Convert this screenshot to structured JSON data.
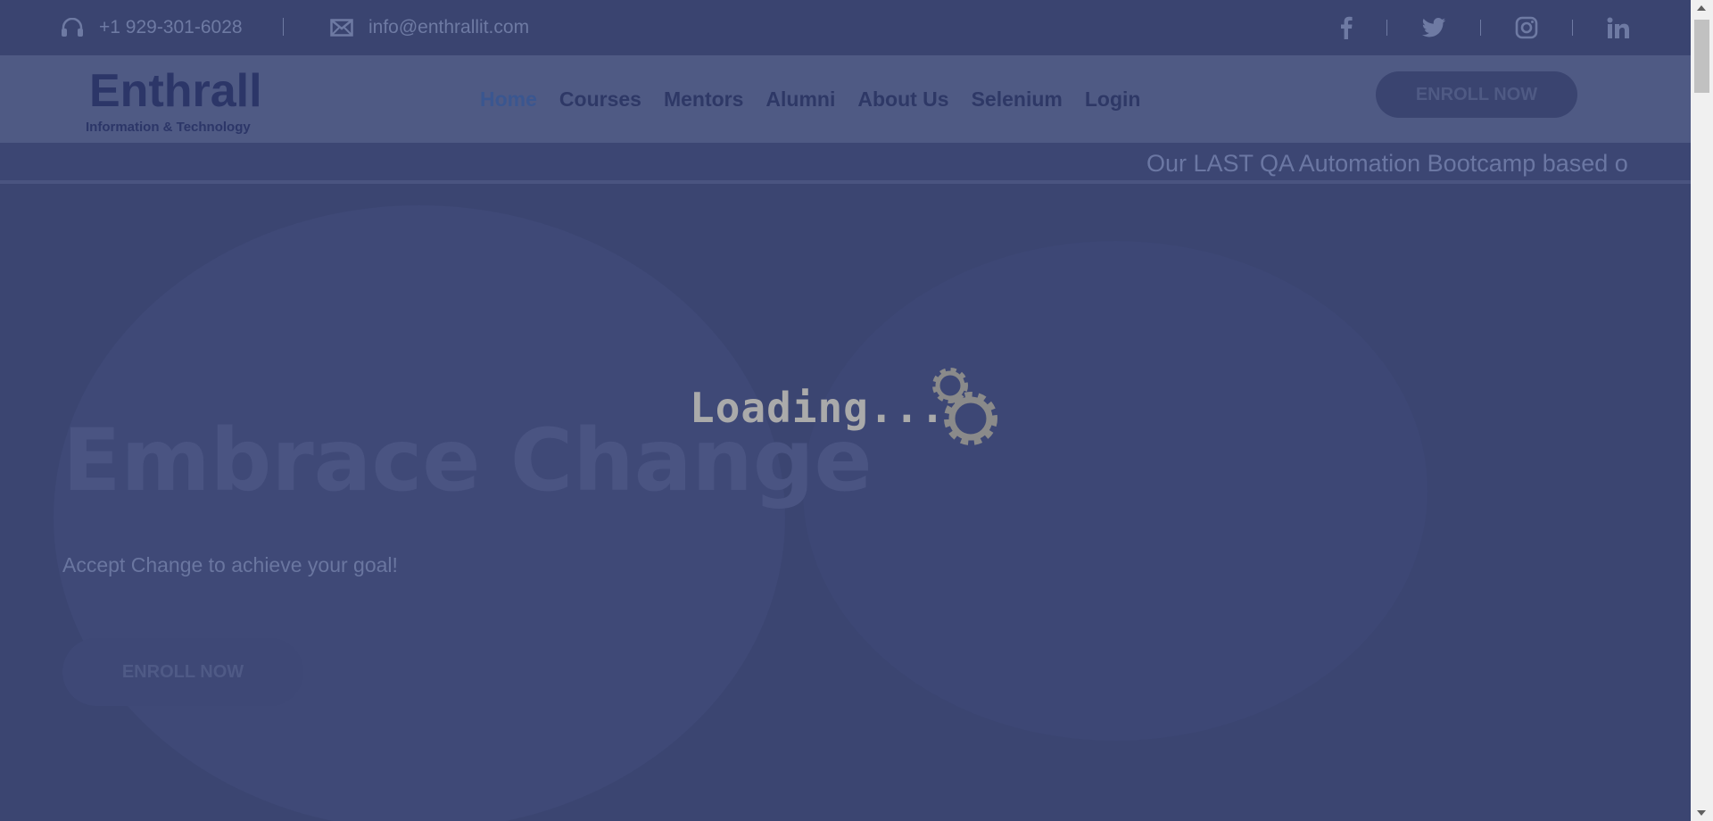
{
  "topbar": {
    "phone": "+1 929-301-6028",
    "email": "info@enthrallit.com",
    "social_icons": [
      "facebook-icon",
      "twitter-icon",
      "instagram-icon",
      "linkedin-icon"
    ]
  },
  "header": {
    "logo_word": "Enthrall",
    "logo_sub": "Information & Technology",
    "nav": [
      "Home",
      "Courses",
      "Mentors",
      "Alumni",
      "About Us",
      "Selenium",
      "Login"
    ],
    "active_nav": "Home",
    "enroll_label": "ENROLL NOW"
  },
  "ticker": {
    "text": "Our LAST QA Automation Bootcamp based o"
  },
  "hero": {
    "title": "Embrace Change",
    "subtitle": "Accept Change to achieve your goal!",
    "button_label": "ENROLL NOW"
  },
  "loader": {
    "text": "Loading..."
  },
  "colors": {
    "overlay": "#3b4571",
    "header": "#4f5a84",
    "nav_text": "#2e3866",
    "loader_text": "#aaaaaa"
  }
}
